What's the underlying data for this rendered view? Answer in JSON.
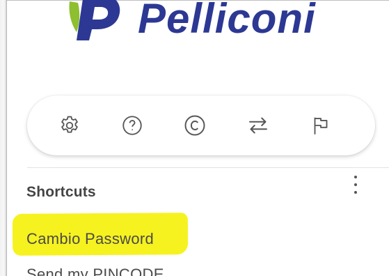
{
  "brand": {
    "name": "Pelliconi",
    "text_color": "#2c3893",
    "mark_colors": {
      "blue": "#2c3893",
      "green": "#8dbf2f"
    }
  },
  "toolbar": {
    "items": [
      {
        "id": "settings",
        "icon": "gear-icon"
      },
      {
        "id": "help",
        "icon": "question-circle-icon"
      },
      {
        "id": "copyright",
        "icon": "copyright-icon"
      },
      {
        "id": "switch",
        "icon": "swap-arrows-icon"
      },
      {
        "id": "flag",
        "icon": "flag-icon"
      }
    ],
    "icon_color": "#555555"
  },
  "shortcuts": {
    "title": "Shortcuts",
    "menu_icon": "kebab-menu-icon",
    "items": [
      {
        "label": "Cambio Password",
        "highlighted": true
      },
      {
        "label": "Send my PINCODE",
        "highlighted": false
      }
    ],
    "highlight_color": "#f6f21f"
  }
}
